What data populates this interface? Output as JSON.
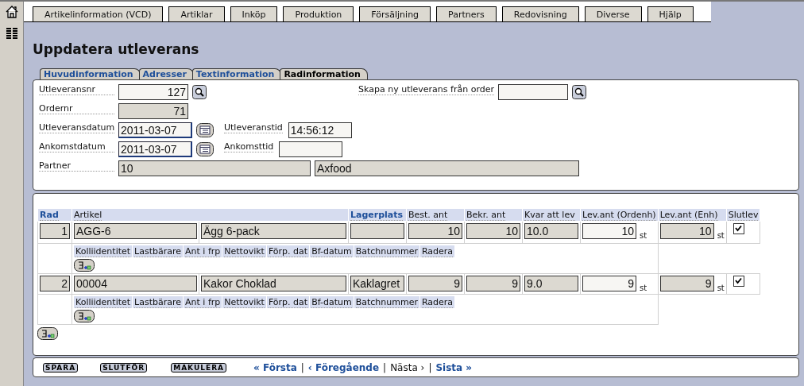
{
  "nav_tabs": [
    "Artikelinformation (VCD)",
    "Artiklar",
    "Inköp",
    "Produktion",
    "Försäljning",
    "Partners",
    "Redovisning",
    "Diverse",
    "Hjälp"
  ],
  "title": "Uppdatera utleverans",
  "subtabs": [
    {
      "label": "Huvudinformation",
      "selected": false
    },
    {
      "label": "Adresser",
      "selected": false
    },
    {
      "label": "Textinformation",
      "selected": false
    },
    {
      "label": "Radinformation",
      "selected": true
    }
  ],
  "form": {
    "delivery_no": {
      "label": "Utleveransnr",
      "value": "127"
    },
    "create_from_order": {
      "label": "Skapa ny utleverans från order"
    },
    "order_no": {
      "label": "Ordernr",
      "value": "71"
    },
    "delivery_date": {
      "label": "Utleveransdatum",
      "value": "2011-03-07"
    },
    "delivery_time": {
      "label": "Utleveranstid",
      "value": "14:56:12"
    },
    "arrival_date": {
      "label": "Ankomstdatum",
      "value": "2011-03-07"
    },
    "arrival_time": {
      "label": "Ankomsttid"
    },
    "partner": {
      "label": "Partner",
      "id": "10",
      "name": "Axfood"
    }
  },
  "table": {
    "columns": [
      {
        "label": "Rad",
        "kind": "sortable"
      },
      {
        "label": "Artikel",
        "kind": "plain"
      },
      {
        "label": "Lagerplats",
        "kind": "sortable"
      },
      {
        "label": "Best. ant",
        "kind": "plain"
      },
      {
        "label": "Bekr. ant",
        "kind": "plain"
      },
      {
        "label": "Kvar att lev",
        "kind": "plain"
      },
      {
        "label": "Lev.ant (Ordenh)",
        "kind": "plain"
      },
      {
        "label": "Lev.ant (Enh)",
        "kind": "plain"
      },
      {
        "label": "Slutlev",
        "kind": "plain"
      }
    ],
    "rows": [
      {
        "rad": "1",
        "article_no": "AGG-6",
        "article_name": "Ägg 6-pack",
        "ordered": "10",
        "confirmed": "10",
        "remaining": "10.0",
        "delivered_order_unit": "10",
        "order_unit": "st",
        "delivered_unit": "10",
        "unit": "st",
        "final": true,
        "package_columns": [
          "Kolliidentitet",
          "Lastbärare",
          "Ant i frp",
          "Nettovikt",
          "Förp. dat",
          "Bf-datum",
          "Batchnummer",
          "Radera"
        ]
      },
      {
        "rad": "2",
        "article_no": "00004",
        "article_name": "Kakor Choklad",
        "location": "Kaklagret",
        "ordered": "9",
        "confirmed": "9",
        "remaining": "9.0",
        "delivered_order_unit": "9",
        "order_unit": "st",
        "delivered_unit": "9",
        "unit": "st",
        "final": true,
        "package_columns": [
          "Kolliidentitet",
          "Lastbärare",
          "Ant i frp",
          "Nettovikt",
          "Förp. dat",
          "Bf-datum",
          "Batchnummer",
          "Radera"
        ]
      }
    ]
  },
  "footer": {
    "buttons": [
      "SPARA",
      "SLUTFÖR",
      "MAKULERA"
    ],
    "pager": [
      {
        "label": "« Första",
        "enabled": true
      },
      {
        "label": "‹ Föregående",
        "enabled": true
      },
      {
        "label": "Nästa ›",
        "enabled": false
      },
      {
        "label": "Sista »",
        "enabled": true
      }
    ],
    "separator": "|"
  }
}
